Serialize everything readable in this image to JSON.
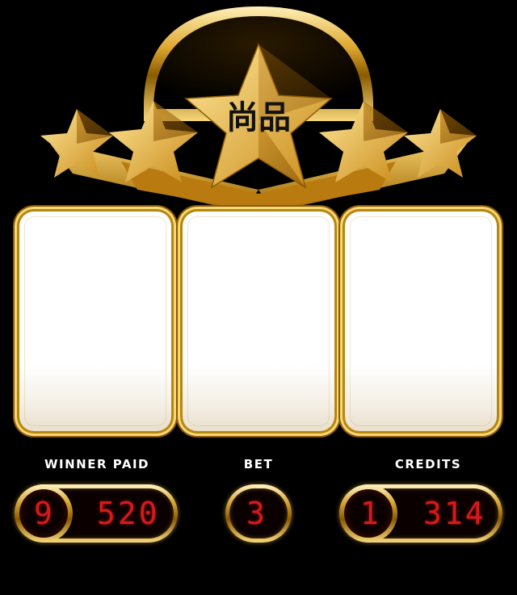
{
  "machine": {
    "logo_text": "尚品"
  },
  "reels": [
    {
      "symbol": ""
    },
    {
      "symbol": ""
    },
    {
      "symbol": ""
    }
  ],
  "winner_paid": {
    "label": "WINNER PAID",
    "lead_digit": "9",
    "value": "520"
  },
  "bet": {
    "label": "BET",
    "value": "3"
  },
  "credits": {
    "label": "CREDITS",
    "lead_digit": "1",
    "value": "314"
  },
  "colors": {
    "gold": "#f5c542",
    "gold_dark": "#8a5a00",
    "digit_red": "#d51a1a",
    "background": "#000000"
  }
}
